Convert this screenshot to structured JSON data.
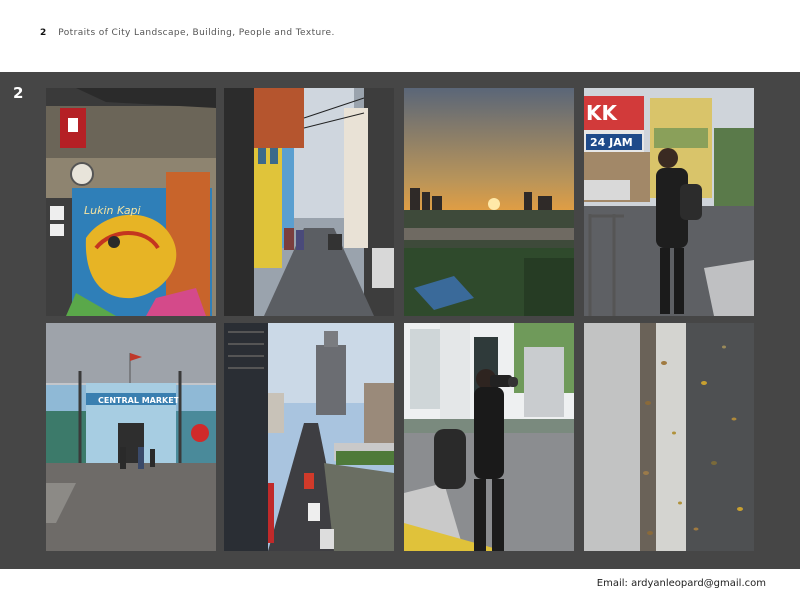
{
  "header": {
    "page_number": "2",
    "title": "Potraits of City Landscape, Building, People and Texture."
  },
  "panel": {
    "number": "2"
  },
  "footer": {
    "email": "Email: ardyanleopard@gmail.com"
  },
  "photos": {
    "mural_sign_text": "Lukin Kapi",
    "billboard_text": "KK",
    "billboard_sub": "24 JAM",
    "market_sign": "CENTRAL MARKET"
  }
}
